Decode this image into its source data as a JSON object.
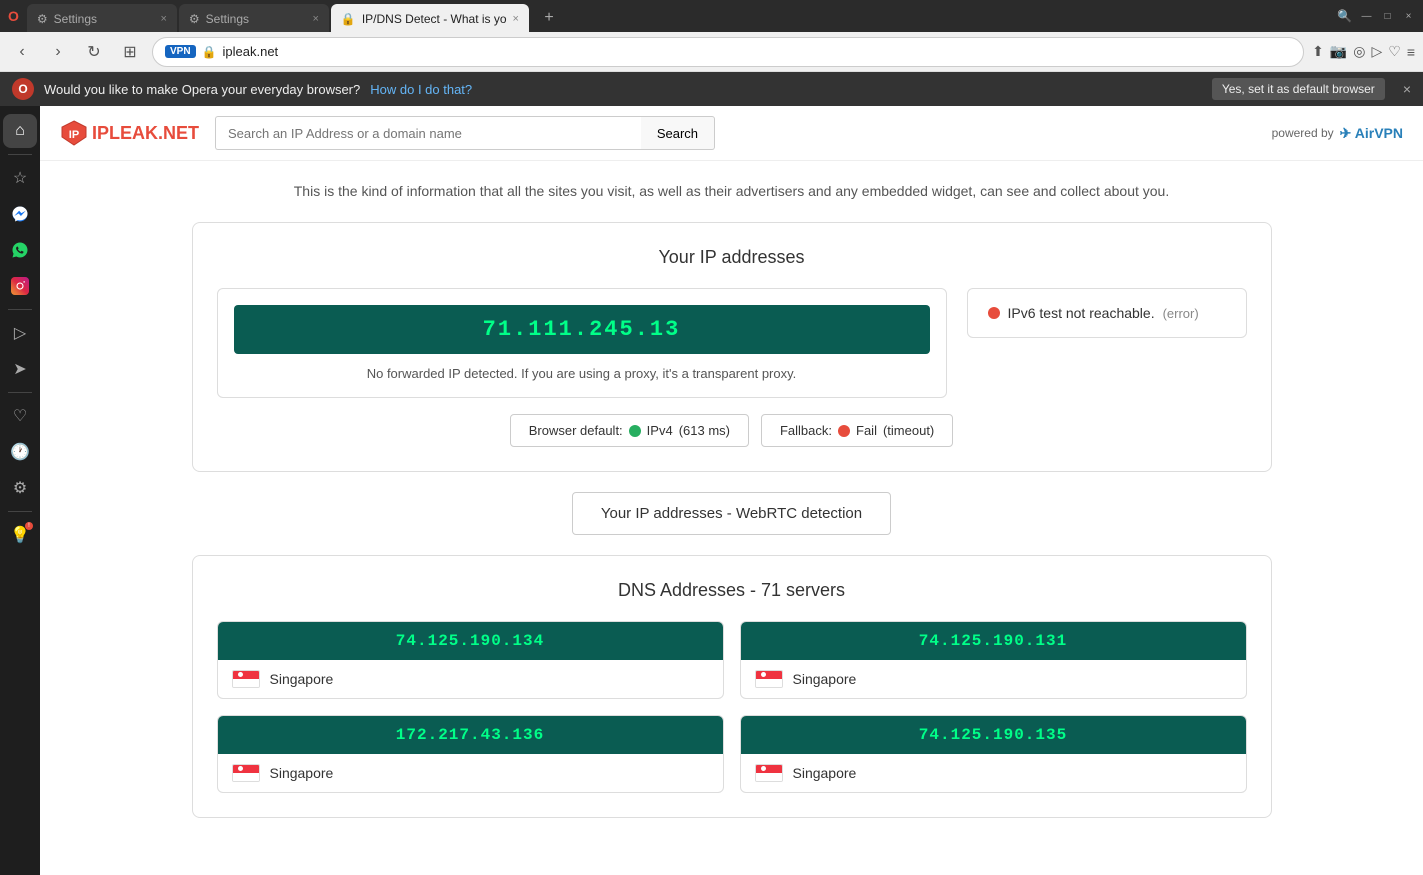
{
  "browser": {
    "tabs": [
      {
        "label": "Settings",
        "icon": "⚙",
        "active": false,
        "id": "tab-settings-1"
      },
      {
        "label": "Settings",
        "icon": "⚙",
        "active": false,
        "id": "tab-settings-2"
      },
      {
        "label": "IP/DNS Detect - What is yo",
        "icon": "🔒",
        "active": true,
        "id": "tab-ipdns"
      }
    ],
    "new_tab_label": "+",
    "nav": {
      "back": "‹",
      "forward": "›",
      "reload": "↻",
      "grid": "⊞"
    },
    "address": "ipleak.net",
    "vpn_label": "VPN",
    "toolbar_icons": [
      "⬆",
      "📷",
      "◎",
      "▷",
      "♡",
      "≡"
    ]
  },
  "notification": {
    "text": "Would you like to make Opera your everyday browser?",
    "link_text": "How do I do that?",
    "btn_label": "Yes, set it as default browser",
    "close": "×"
  },
  "sidebar": {
    "icons": [
      {
        "name": "home-icon",
        "symbol": "⌂",
        "active": true
      },
      {
        "name": "bookmarks-icon",
        "symbol": "☆",
        "active": false
      },
      {
        "name": "messenger-icon",
        "symbol": "💬",
        "active": false
      },
      {
        "name": "whatsapp-icon",
        "symbol": "📱",
        "active": false
      },
      {
        "name": "instagram-icon",
        "symbol": "📷",
        "active": false
      },
      {
        "name": "player-icon",
        "symbol": "▶",
        "active": false
      },
      {
        "name": "send-icon",
        "symbol": "➤",
        "active": false
      },
      {
        "name": "heart-icon",
        "symbol": "♡",
        "active": false
      },
      {
        "name": "history-icon",
        "symbol": "🕐",
        "active": false
      },
      {
        "name": "settings-icon",
        "symbol": "⚙",
        "active": false
      },
      {
        "name": "notifications-icon",
        "symbol": "💡",
        "active": false,
        "has_badge": true
      }
    ]
  },
  "site": {
    "logo": "IPLEAK.NET",
    "search_placeholder": "Search an IP Address or a domain name",
    "search_label": "Search",
    "powered_by": "powered by",
    "airvpn_label": "AirVPN"
  },
  "content": {
    "tagline": "This is the kind of information that all the sites you visit, as well as their advertisers and any embedded widget, can see and collect about you.",
    "ip_section": {
      "title": "Your IP addresses",
      "ip_address": "71.111.245.13",
      "no_forwarded": "No forwarded IP detected. If you are using a proxy, it's a transparent proxy.",
      "ipv6_label": "IPv6 test not reachable.",
      "ipv6_error": "(error)",
      "browser_default_label": "Browser default:",
      "browser_default_status": "IPv4",
      "browser_default_ms": "(613 ms)",
      "fallback_label": "Fallback:",
      "fallback_status": "Fail",
      "fallback_timeout": "(timeout)"
    },
    "webrtc": {
      "label": "Your IP addresses - WebRTC detection"
    },
    "dns_section": {
      "title": "DNS Addresses - 71 servers",
      "servers": [
        {
          "ip": "74.125.190.134",
          "country": "Singapore"
        },
        {
          "ip": "74.125.190.131",
          "country": "Singapore"
        },
        {
          "ip": "172.217.43.136",
          "country": "Singapore"
        },
        {
          "ip": "74.125.190.135",
          "country": "Singapore"
        }
      ]
    }
  },
  "colors": {
    "ip_bg": "#0a5c52",
    "ip_text": "#00ff88",
    "dot_green": "#27ae60",
    "dot_red": "#e74c3c"
  }
}
